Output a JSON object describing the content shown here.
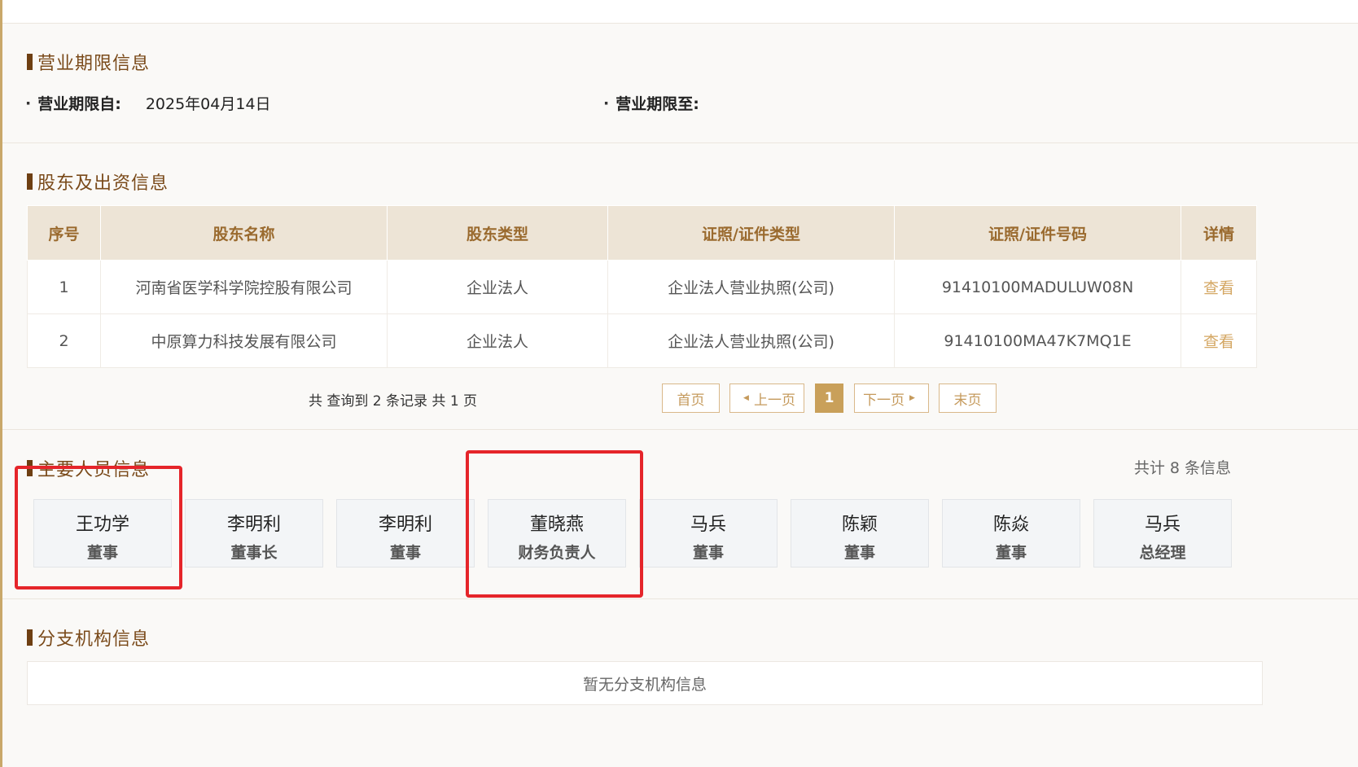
{
  "business_term": {
    "title": "营业期限信息",
    "from_label": "营业期限自:",
    "from_value": "2025年04月14日",
    "to_label": "营业期限至:",
    "to_value": ""
  },
  "shareholders": {
    "title": "股东及出资信息",
    "columns": [
      "序号",
      "股东名称",
      "股东类型",
      "证照/证件类型",
      "证照/证件号码",
      "详情"
    ],
    "rows": [
      [
        "1",
        "河南省医学科学院控股有限公司",
        "企业法人",
        "企业法人营业执照(公司)",
        "91410100MADULUW08N",
        "查看"
      ],
      [
        "2",
        "中原算力科技发展有限公司",
        "企业法人",
        "企业法人营业执照(公司)",
        "91410100MA47K7MQ1E",
        "查看"
      ]
    ],
    "records_text": "共 查询到 2 条记录 共 1 页",
    "pagination": {
      "first": "首页",
      "prev": "上一页",
      "current": "1",
      "next": "下一页",
      "last": "末页"
    }
  },
  "personnel": {
    "title": "主要人员信息",
    "total_text": "共计 8 条信息",
    "people": [
      {
        "name": "王功学",
        "role": "董事"
      },
      {
        "name": "李明利",
        "role": "董事长"
      },
      {
        "name": "李明利",
        "role": "董事"
      },
      {
        "name": "董晓燕",
        "role": "财务负责人"
      },
      {
        "name": "马兵",
        "role": "董事"
      },
      {
        "name": "陈颖",
        "role": "董事"
      },
      {
        "name": "陈焱",
        "role": "董事"
      },
      {
        "name": "马兵",
        "role": "总经理"
      }
    ]
  },
  "branches": {
    "title": "分支机构信息",
    "empty_text": "暂无分支机构信息"
  },
  "colors": {
    "accent": "#c9a05a",
    "title": "#7a4a1a",
    "highlight": "#e5252a"
  }
}
